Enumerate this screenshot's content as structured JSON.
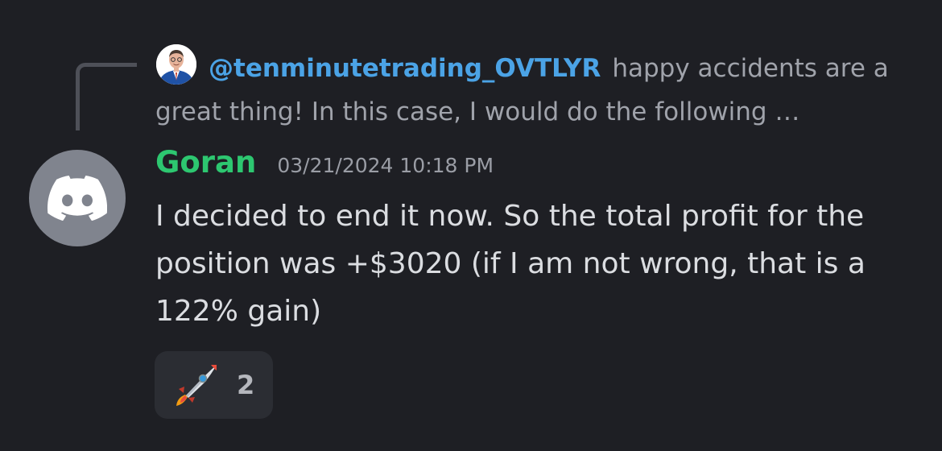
{
  "reply": {
    "mention": "@tenminutetrading_OVTLYR",
    "preview": "happy accidents are a great thing! In this case, I would do the following …"
  },
  "message": {
    "username": "Goran",
    "timestamp": "03/21/2024 10:18 PM",
    "content": "I decided to end it now. So the total profit for the position was +$3020 (if I am not wrong, that is a 122% gain)"
  },
  "reactions": [
    {
      "emoji": "rocket-icon",
      "count": "2"
    }
  ],
  "colors": {
    "background": "#1e1f24",
    "mention": "#4ba3e6",
    "username": "#2dc770",
    "avatar_bg": "#80848e",
    "reaction_bg": "#2b2d33"
  }
}
